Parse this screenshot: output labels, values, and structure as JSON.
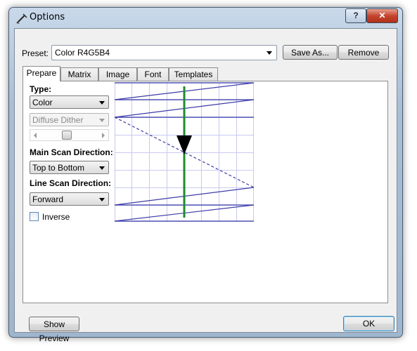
{
  "window": {
    "title": "Options",
    "help_label": "?",
    "close_label": "✕"
  },
  "preset": {
    "label": "Preset:",
    "value": "Color R4G5B4",
    "save_as_label": "Save As...",
    "remove_label": "Remove"
  },
  "tabs": [
    {
      "label": "Prepare",
      "active": true
    },
    {
      "label": "Matrix"
    },
    {
      "label": "Image"
    },
    {
      "label": "Font"
    },
    {
      "label": "Templates"
    }
  ],
  "prepare": {
    "type_label": "Type:",
    "type_value": "Color",
    "dither_value": "Diffuse Dither",
    "dither_enabled": false,
    "dither_slider_fraction": 0.45,
    "main_scan_label": "Main Scan Direction:",
    "main_scan_value": "Top to Bottom",
    "line_scan_label": "Line Scan Direction:",
    "line_scan_value": "Forward",
    "inverse_label": "Inverse",
    "inverse_checked": false
  },
  "footer": {
    "preview_label": "Show Preview",
    "ok_label": "OK"
  },
  "colors": {
    "scan_line": "#3b3ba8",
    "main_direction": "#1d8c2e",
    "grid": "#c9c9f0"
  }
}
